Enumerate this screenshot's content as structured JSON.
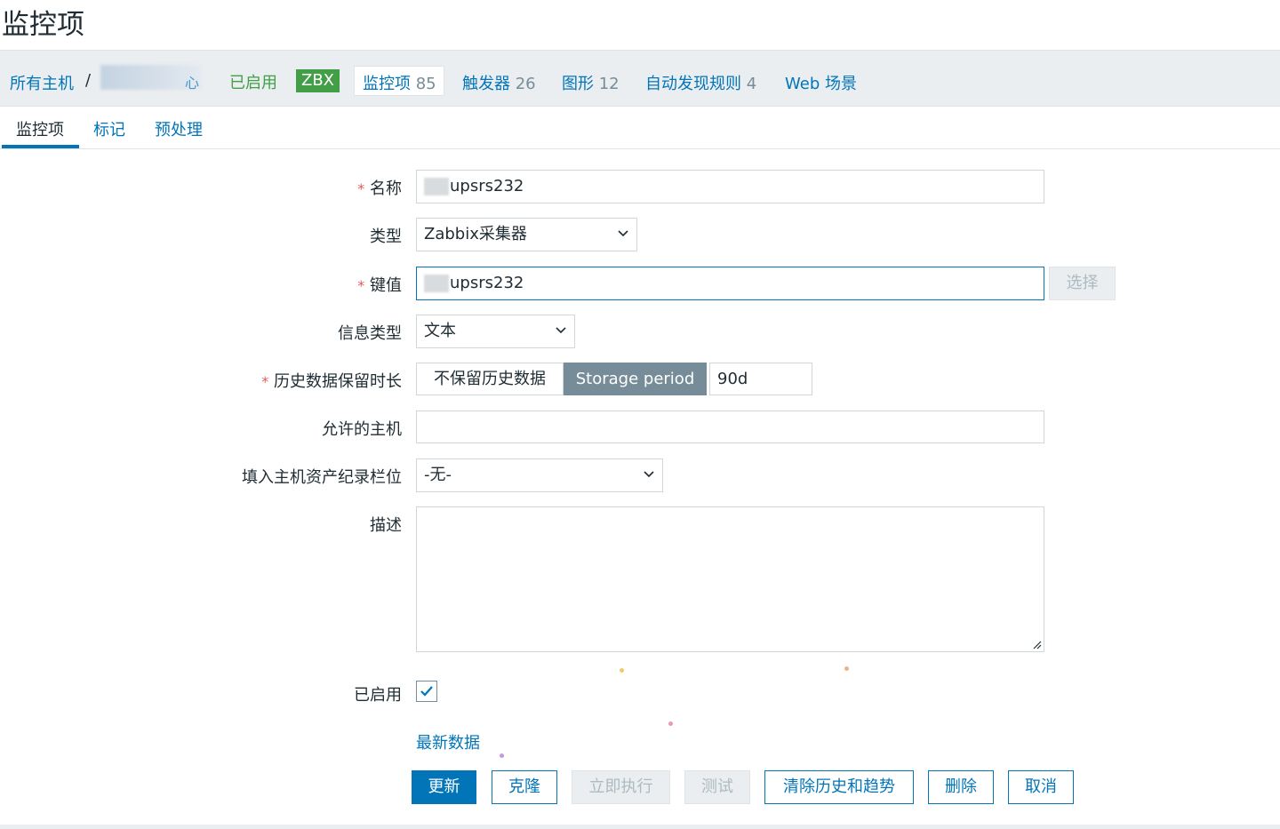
{
  "page": {
    "title": "监控项"
  },
  "breadcrumb": {
    "all_hosts": "所有主机",
    "separator": "/",
    "host_name_tail": "心",
    "status": "已启用",
    "zbx_badge": "ZBX",
    "items": {
      "label": "监控项",
      "count": "85"
    },
    "triggers": {
      "label": "触发器",
      "count": "26"
    },
    "graphs": {
      "label": "图形",
      "count": "12"
    },
    "discovery": {
      "label": "自动发现规则",
      "count": "4"
    },
    "web": {
      "label": "Web 场景"
    }
  },
  "tabs": [
    {
      "label": "监控项",
      "active": true
    },
    {
      "label": "标记",
      "active": false
    },
    {
      "label": "预处理",
      "active": false
    }
  ],
  "form": {
    "required_mark": "*",
    "name": {
      "label": "名称",
      "value": "upsrs232"
    },
    "type": {
      "label": "类型",
      "value": "Zabbix采集器"
    },
    "key": {
      "label": "键值",
      "value": "upsrs232",
      "select_button": "选择"
    },
    "value_type": {
      "label": "信息类型",
      "value": "文本"
    },
    "history": {
      "label": "历史数据保留时长",
      "option_no_keep": "不保留历史数据",
      "option_storage": "Storage period",
      "selected": "Storage period",
      "value": "90d"
    },
    "allowed_hosts": {
      "label": "允许的主机",
      "value": ""
    },
    "inventory": {
      "label": "填入主机资产纪录栏位",
      "value": "-无-"
    },
    "description": {
      "label": "描述",
      "value": ""
    },
    "enabled": {
      "label": "已启用",
      "checked": true
    },
    "latest_data_link": "最新数据"
  },
  "buttons": {
    "update": "更新",
    "clone": "克隆",
    "execute_now": "立即执行",
    "test": "测试",
    "clear_history": "清除历史和趋势",
    "delete": "删除",
    "cancel": "取消"
  },
  "colors": {
    "link": "#0275b8",
    "enabled_green": "#429e47",
    "required_red": "#e45959",
    "segment_selected": "#768d99",
    "breadcrumb_bg": "#ebeef0"
  }
}
